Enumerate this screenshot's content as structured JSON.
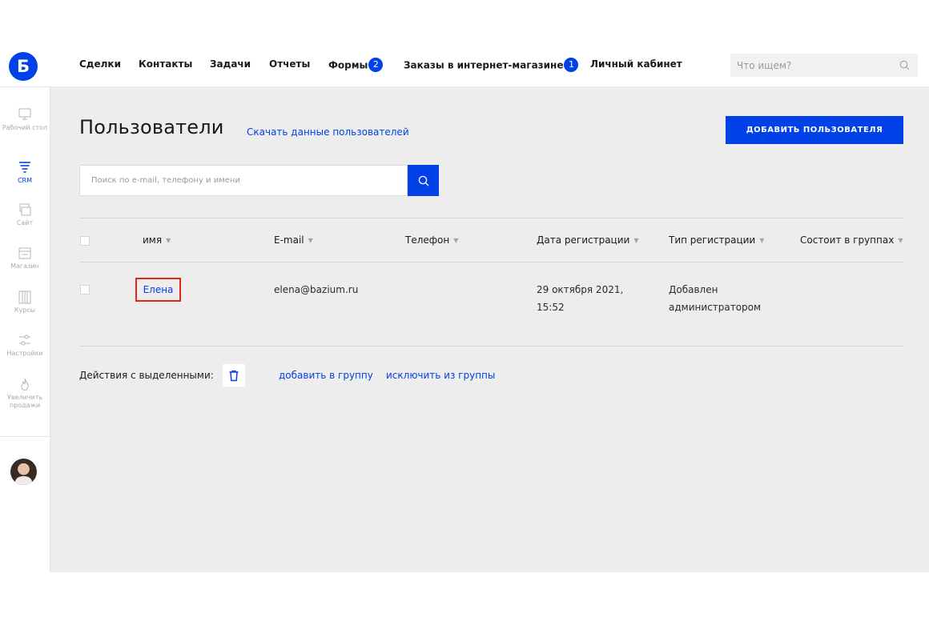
{
  "logo": "Б",
  "sidebar": {
    "items": [
      {
        "label": "Рабочий стол",
        "icon": "desktop-icon",
        "active": false
      },
      {
        "label": "CRM",
        "icon": "funnel-icon",
        "active": true
      },
      {
        "label": "Сайт",
        "icon": "site-icon",
        "active": false
      },
      {
        "label": "Магазин",
        "icon": "store-icon",
        "active": false
      },
      {
        "label": "Курсы",
        "icon": "books-icon",
        "active": false
      },
      {
        "label": "Настройки",
        "icon": "sliders-icon",
        "active": false
      },
      {
        "label": "Увеличить продажи",
        "icon": "flame-icon",
        "active": false
      }
    ]
  },
  "topnav": {
    "items": [
      {
        "label": "Сделки"
      },
      {
        "label": "Контакты"
      },
      {
        "label": "Задачи"
      },
      {
        "label": "Отчеты"
      },
      {
        "label": "Формы",
        "badge": "2"
      },
      {
        "label": "Заказы в интернет-магазине",
        "badge": "1"
      },
      {
        "label": "Личный кабинет"
      }
    ],
    "search_placeholder": "Что ищем?"
  },
  "page": {
    "title": "Пользователи",
    "download_link": "Скачать данные пользователей",
    "add_button": "ДОБАВИТЬ ПОЛЬЗОВАТЕЛЯ",
    "search_placeholder": "Поиск по e-mail, телефону и имени"
  },
  "table": {
    "columns": [
      "имя",
      "E-mail",
      "Телефон",
      "Дата регистрации",
      "Тип регистрации",
      "Состоит в группах"
    ],
    "rows": [
      {
        "name": "Елена",
        "email": "elena@bazium.ru",
        "phone": "",
        "date_line1": "29 октября 2021,",
        "date_line2": "15:52",
        "reg_type_line1": "Добавлен",
        "reg_type_line2": "администратором",
        "groups": ""
      }
    ]
  },
  "actions": {
    "label": "Действия с выделенными:",
    "add_to_group": "добавить в группу",
    "remove_from_group": "исключить из группы"
  },
  "colors": {
    "accent": "#0041e8",
    "highlight": "#e1251b",
    "background": "#ededed"
  }
}
